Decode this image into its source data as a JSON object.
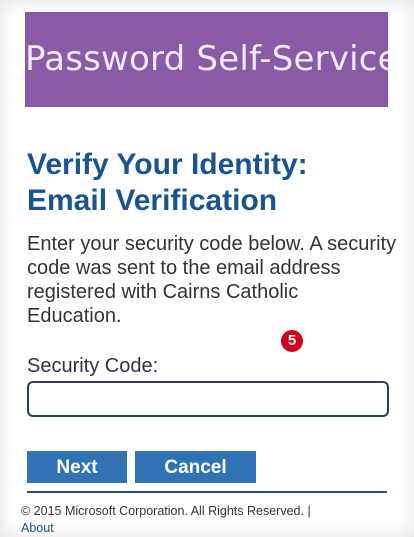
{
  "banner": {
    "title": "Password Self-Service",
    "color": "#8a5aa6"
  },
  "main": {
    "heading_line1": "Verify Your Identity:",
    "heading_line2": "Email Verification",
    "description": "Enter your security code below. A security code was sent to the email address registered with Cairns Catholic Education.",
    "badge": "5",
    "security_code_label": "Security Code:",
    "security_code_value": "",
    "security_code_placeholder": ""
  },
  "buttons": {
    "next_label": "Next",
    "cancel_label": "Cancel",
    "color": "#2f73b5"
  },
  "footer": {
    "copyright": "© 2015 Microsoft Corporation. All Rights Reserved.",
    "separator": "|",
    "about_link": "About"
  }
}
